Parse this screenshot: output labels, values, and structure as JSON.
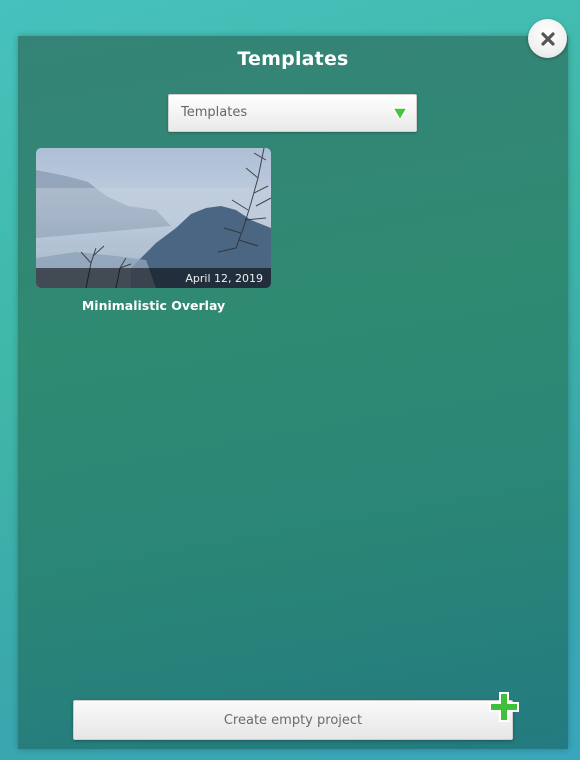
{
  "dialog": {
    "title": "Templates"
  },
  "dropdown": {
    "selected": "Templates",
    "icon": "chevron-down-icon",
    "arrow_color": "#3fbf3a"
  },
  "templates": [
    {
      "name": "Minimalistic Overlay",
      "date": "April 12, 2019",
      "thumbnail": "misty-mountain-landscape"
    }
  ],
  "footer": {
    "create_label": "Create empty project",
    "plus_icon": "plus-icon",
    "plus_color": "#3fbf3a"
  },
  "close": {
    "icon": "close-icon"
  },
  "colors": {
    "panel": "#2f8775",
    "background": "#42b8b0"
  }
}
